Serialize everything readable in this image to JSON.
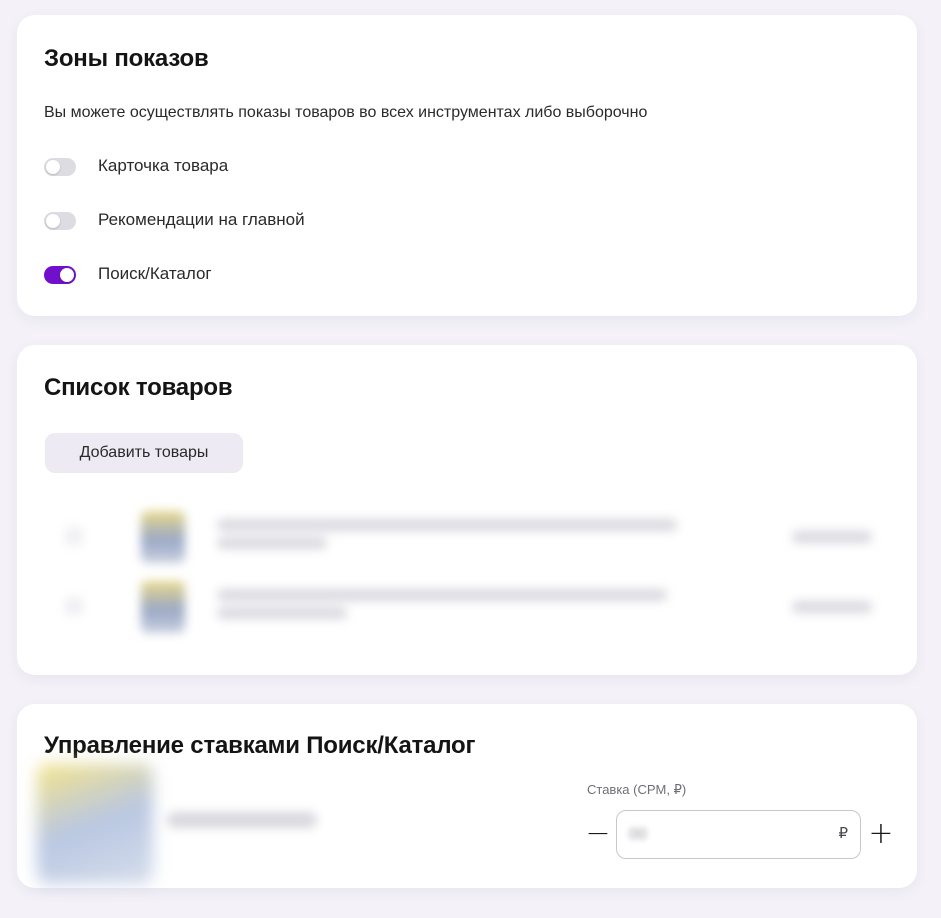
{
  "zones": {
    "title": "Зоны показов",
    "description": "Вы можете осуществлять показы товаров во всех инструментах либо выборочно",
    "items": [
      {
        "label": "Карточка товара",
        "enabled": false
      },
      {
        "label": "Рекомендации на главной",
        "enabled": false
      },
      {
        "label": "Поиск/Каталог",
        "enabled": true
      }
    ]
  },
  "products": {
    "title": "Список товаров",
    "add_button": "Добавить товары"
  },
  "bids": {
    "title": "Управление ставками Поиск/Каталог",
    "rate_label": "Ставка (CPM, ₽)",
    "currency": "₽",
    "minus": "−",
    "plus": "+"
  },
  "colors": {
    "accent": "#7110cc",
    "toggle_off": "#dcdce2",
    "background": "#f4f2f8",
    "card": "#ffffff"
  }
}
